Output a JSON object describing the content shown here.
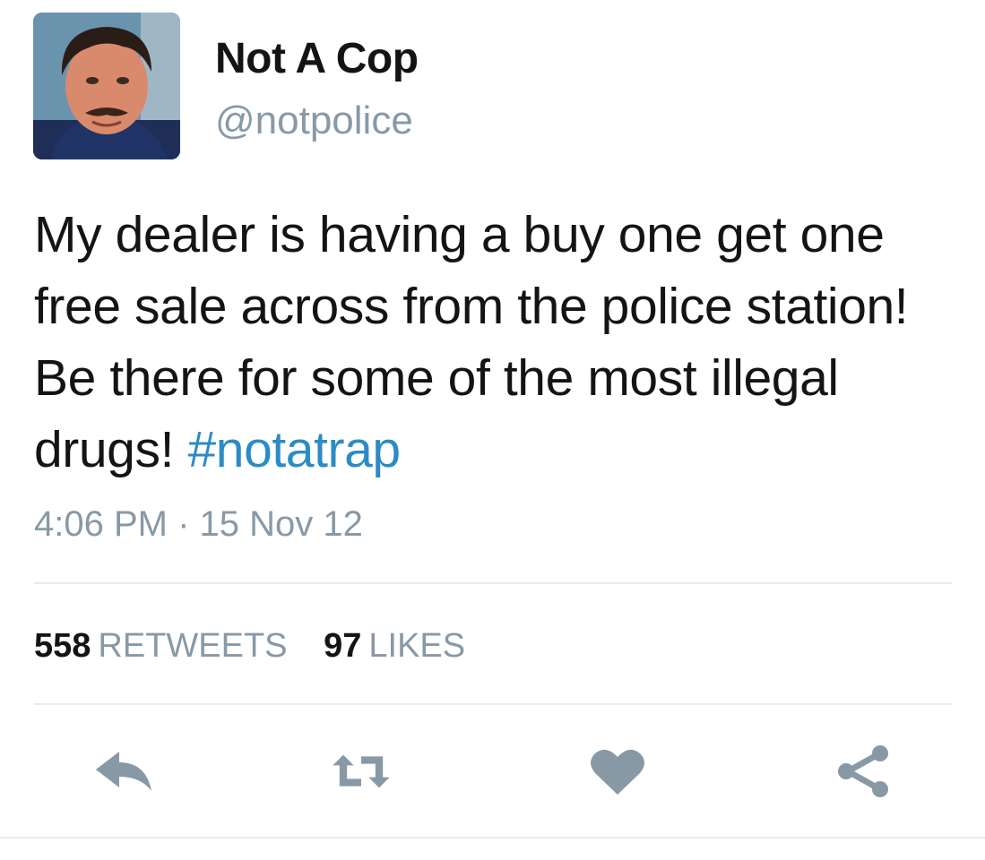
{
  "user": {
    "display_name": "Not A Cop",
    "handle": "@notpolice",
    "avatar_icon": "profile-photo"
  },
  "tweet": {
    "text_before": "My dealer is having a buy one get one free sale across from the police station! Be there for some of the most illegal drugs!",
    "hashtag": "#notatrap",
    "time": "4:06 PM",
    "separator": "·",
    "date": "15 Nov 12"
  },
  "stats": {
    "retweets_count": "558",
    "retweets_label": "RETWEETS",
    "likes_count": "97",
    "likes_label": "LIKES"
  },
  "actions": {
    "reply_icon": "reply-icon",
    "retweet_icon": "retweet-icon",
    "like_icon": "heart-icon",
    "share_icon": "share-icon"
  },
  "colors": {
    "text": "#141414",
    "muted": "#8899a6",
    "hashtag": "#2b8cc4",
    "divider": "#e6ecf0"
  }
}
